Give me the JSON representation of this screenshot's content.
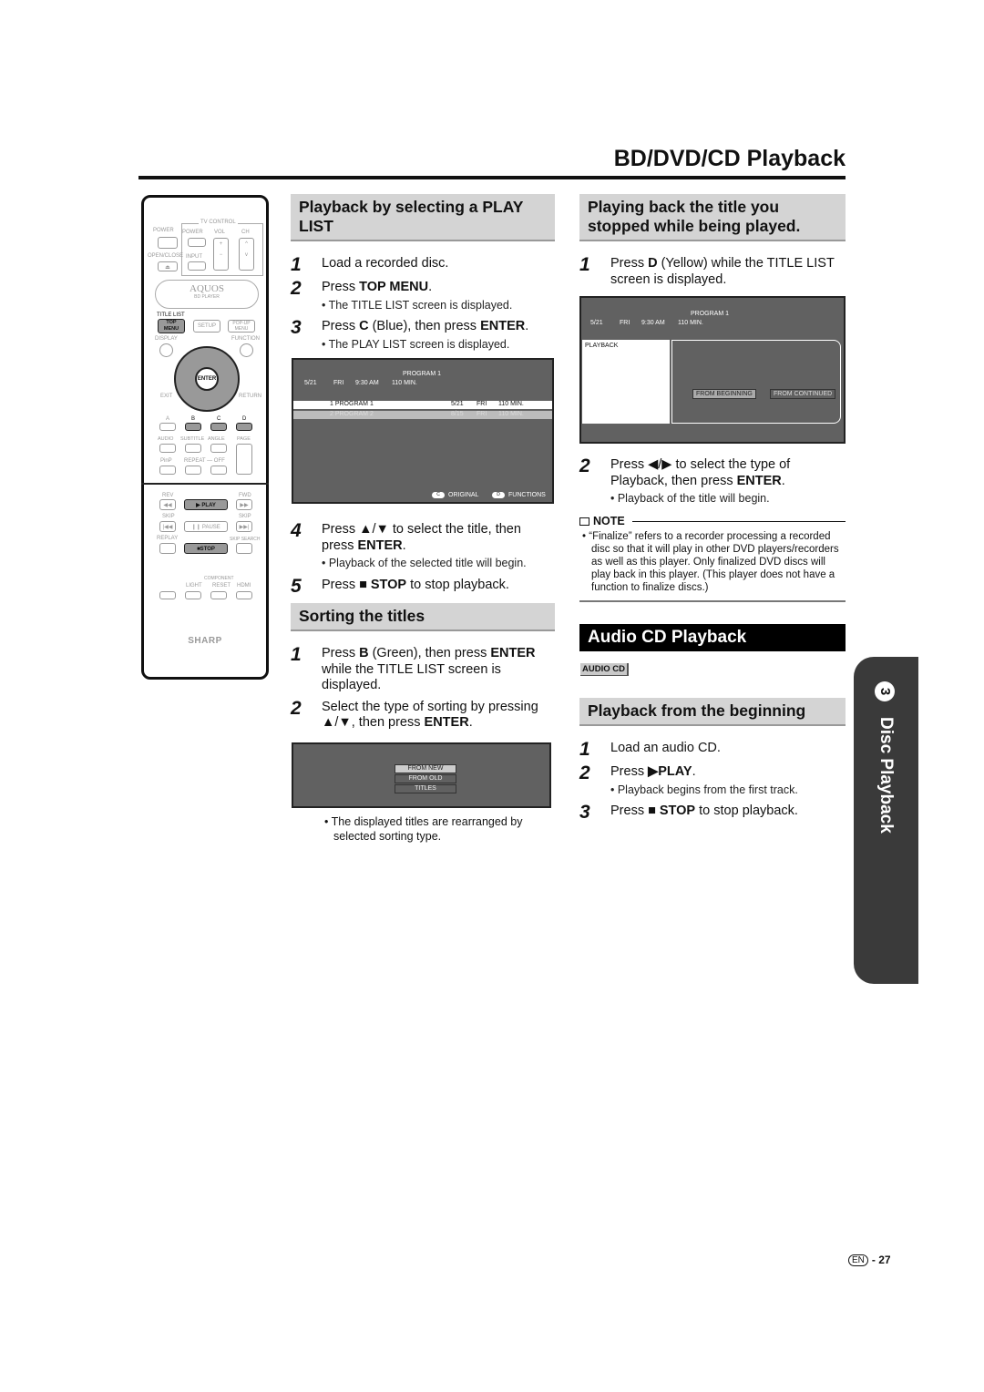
{
  "page_title": "BD/DVD/CD Playback",
  "remote": {
    "tv_control": "TV CONTROL",
    "power": "POWER",
    "power2": "POWER",
    "vol": "VOL",
    "ch": "CH",
    "open_close": "OPEN/CLOSE",
    "input": "INPUT",
    "brand_top": "AQUOS",
    "brand_sub": "BD PLAYER",
    "title_list": "TITLE LIST",
    "top_menu": "TOP MENU",
    "setup": "SETUP",
    "popup_menu": "POP-UP MENU",
    "display": "DISPLAY",
    "function": "FUNCTION",
    "enter": "ENTER",
    "exit": "EXIT",
    "return": "RETURN",
    "a": "A",
    "b": "B",
    "c": "C",
    "d": "D",
    "audio": "AUDIO",
    "subtitle": "SUBTITLE",
    "angle": "ANGLE",
    "page": "PAGE",
    "pinp": "PinP",
    "repeat": "REPEAT — OFF",
    "rev": "REV",
    "fwd": "FWD",
    "play": "▶ PLAY",
    "skip_l": "SKIP",
    "skip_r": "SKIP",
    "pause": "❙❙ PAUSE",
    "replay": "REPLAY",
    "skip_search": "SKIP SEARCH",
    "stop": "■STOP",
    "component": "COMPONENT",
    "light": "LIGHT",
    "reset": "RESET",
    "hdmi": "HDMI",
    "maker": "SHARP"
  },
  "play_list": {
    "heading": "Playback by selecting a PLAY LIST",
    "steps": [
      {
        "n": "1",
        "text": "Load a recorded disc."
      },
      {
        "n": "2",
        "pre": "Press ",
        "bold": "TOP MENU",
        "post": ".",
        "note": "• The TITLE LIST screen is displayed."
      },
      {
        "n": "3",
        "pre": "Press ",
        "bold": "C",
        "post": " (Blue), then press ",
        "bold2": "ENTER",
        "post2": ".",
        "note": "• The PLAY LIST screen is displayed."
      }
    ],
    "screen": {
      "program": "PROGRAM 1",
      "date": "5/21",
      "day": "FRI",
      "time": "9:30 AM",
      "len": "110 MIN.",
      "rows": [
        [
          "1  PROGRAM 1",
          "5/21",
          "FRI",
          "110 MIN."
        ],
        [
          "2  PROGRAM 2",
          "8/15",
          "FRI",
          "110 MIN."
        ]
      ],
      "btn_c": "C",
      "original": "ORIGINAL",
      "btn_d": "D",
      "functions": "FUNCTIONS"
    },
    "steps2": [
      {
        "n": "4",
        "pre": "Press ▲/▼ to select the title, then press ",
        "bold": "ENTER",
        "post": ".",
        "note": "• Playback of the selected title will begin."
      },
      {
        "n": "5",
        "pre": "Press ■ ",
        "bold": "STOP",
        "post": " to stop playback."
      }
    ]
  },
  "sorting": {
    "heading": "Sorting the titles",
    "steps": [
      {
        "n": "1",
        "pre": "Press ",
        "bold": "B",
        "post": " (Green), then press ",
        "bold2": "ENTER",
        "post2": " while the TITLE LIST screen is displayed."
      },
      {
        "n": "2",
        "pre": "Select the type of sorting by pressing ▲/▼, then press ",
        "bold": "ENTER",
        "post": "."
      }
    ],
    "options": [
      "FROM NEW",
      "FROM OLD",
      "TITLES"
    ],
    "note": "The displayed titles are rearranged by selected sorting type."
  },
  "resume": {
    "heading": "Playing back the title you stopped while being played.",
    "step1": {
      "n": "1",
      "pre": "Press ",
      "bold": "D",
      "post": " (Yellow) while the TITLE LIST screen is displayed."
    },
    "screen": {
      "program": "PROGRAM 1",
      "date": "5/21",
      "day": "FRI",
      "time": "9:30 AM",
      "len": "110 MIN.",
      "panel": "PLAYBACK",
      "from_beginning": "FROM BEGINNING",
      "from_continued": "FROM CONTINUED"
    },
    "step2": {
      "n": "2",
      "pre": "Press ◀/▶ to select the type of Playback, then press ",
      "bold": "ENTER",
      "post": ".",
      "note": "• Playback of the title will begin."
    },
    "note_label": "NOTE",
    "note": "“Finalize” refers to a recorder processing a recorded disc so that it will play in other DVD players/recorders as well as this player. Only finalized DVD discs will play back in this player. (This player does not have a function to finalize discs.)"
  },
  "audio_cd": {
    "heading": "Audio CD Playback",
    "badge": "AUDIO CD",
    "sub_heading": "Playback from the beginning",
    "steps": [
      {
        "n": "1",
        "text": "Load an audio CD."
      },
      {
        "n": "2",
        "pre": "Press ",
        "bold": "▶PLAY",
        "post": ".",
        "note": "• Playback begins from the first track."
      },
      {
        "n": "3",
        "pre": "Press ■ ",
        "bold": "STOP",
        "post": " to stop playback."
      }
    ]
  },
  "side_tab": {
    "number": "3",
    "label": "Disc Playback"
  },
  "footer": {
    "lang": "EN",
    "page": "- 27"
  }
}
